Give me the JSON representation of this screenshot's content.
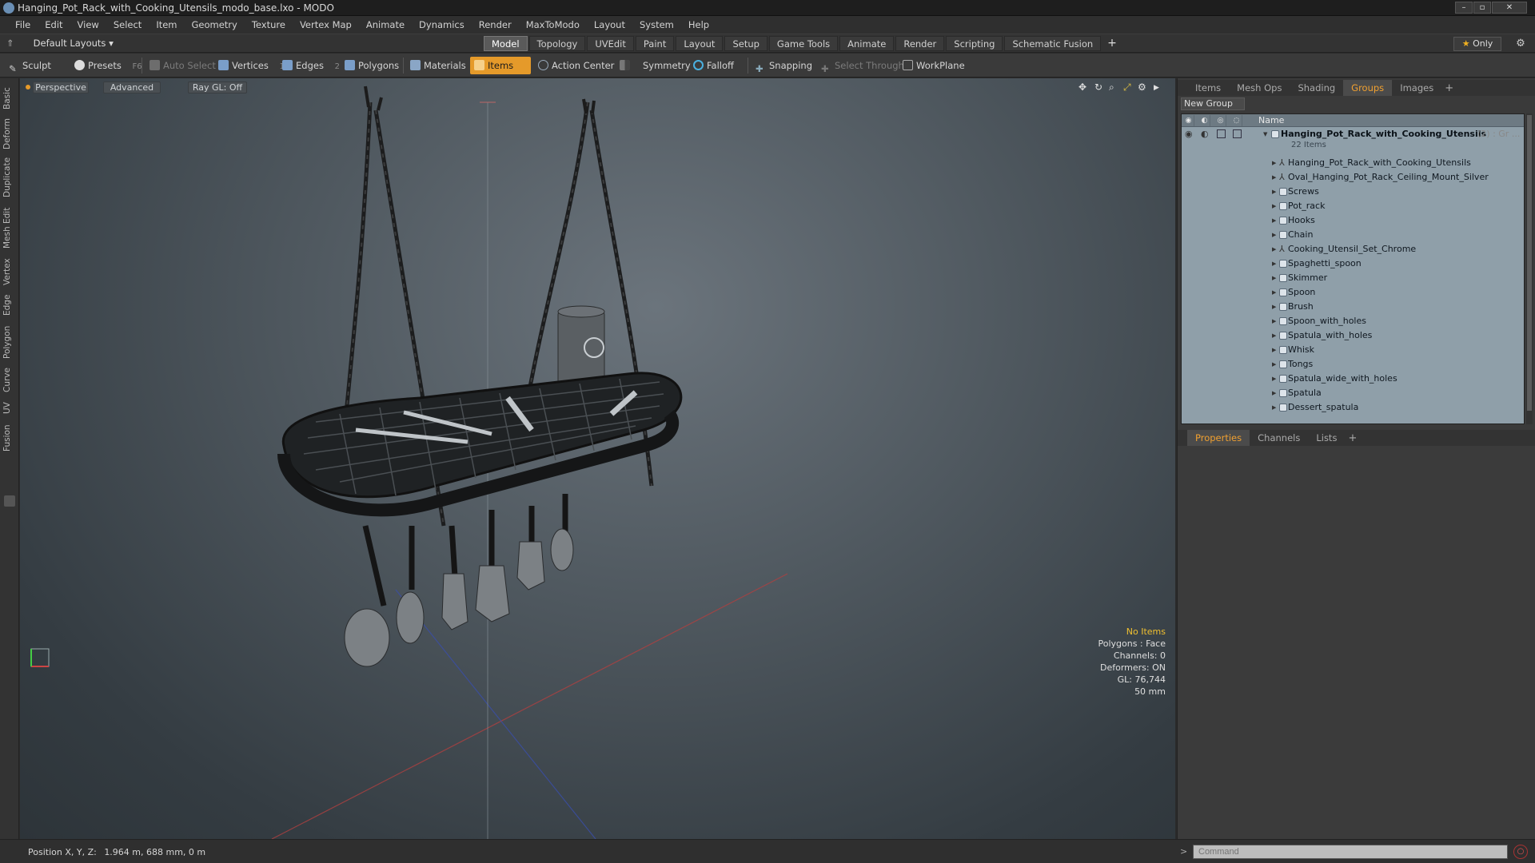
{
  "window": {
    "title": "Hanging_Pot_Rack_with_Cooking_Utensils_modo_base.lxo - MODO"
  },
  "menu": [
    "File",
    "Edit",
    "View",
    "Select",
    "Item",
    "Geometry",
    "Texture",
    "Vertex Map",
    "Animate",
    "Dynamics",
    "Render",
    "MaxToModo",
    "Layout",
    "System",
    "Help"
  ],
  "layout": {
    "selector": "Default Layouts",
    "tabs": [
      "Model",
      "Topology",
      "UVEdit",
      "Paint",
      "Layout",
      "Setup",
      "Game Tools",
      "Animate",
      "Render",
      "Scripting",
      "Schematic Fusion"
    ],
    "active_tab": "Model",
    "plus": "+",
    "only_label": "Only"
  },
  "toolbar": {
    "sculpt": "Sculpt",
    "presets": "Presets",
    "presets_key": "F6",
    "auto_select": "Auto Select",
    "vertices": "Vertices",
    "vertices_count": "1",
    "edges": "Edges",
    "edges_count": "2",
    "polygons": "Polygons",
    "materials": "Materials",
    "items": "Items",
    "action_center": "Action Center",
    "symmetry": "Symmetry",
    "falloff": "Falloff",
    "snapping": "Snapping",
    "select_through": "Select Through",
    "workplane": "WorkPlane"
  },
  "left_tabs": [
    "Basic",
    "Deform",
    "Duplicate",
    "Mesh Edit",
    "Vertex",
    "Edge",
    "Polygon",
    "Curve",
    "UV",
    "Fusion"
  ],
  "viewport": {
    "perspective": "Perspective",
    "advanced": "Advanced",
    "raygl": "Ray GL: Off",
    "info": {
      "no_items": "No Items",
      "polygons": "Polygons : Face",
      "channels": "Channels: 0",
      "deformers": "Deformers: ON",
      "gl": "GL: 76,744",
      "scale": "50 mm"
    }
  },
  "right_panel": {
    "top_tabs": [
      "Items",
      "Mesh Ops",
      "Shading",
      "Groups",
      "Images"
    ],
    "top_active": "Groups",
    "new_group": "New Group",
    "name_header": "Name",
    "root_name": "Hanging_Pot_Rack_with_Cooking_Utensils",
    "root_suffix": "(2) : Gr ...",
    "root_count": "22 Items",
    "items": [
      {
        "name": "Hanging_Pot_Rack_with_Cooking_Utensils",
        "kind": "locator"
      },
      {
        "name": "Oval_Hanging_Pot_Rack_Ceiling_Mount_Silver",
        "kind": "locator"
      },
      {
        "name": "Screws",
        "kind": "mesh"
      },
      {
        "name": "Pot_rack",
        "kind": "mesh"
      },
      {
        "name": "Hooks",
        "kind": "mesh"
      },
      {
        "name": "Chain",
        "kind": "mesh"
      },
      {
        "name": "Cooking_Utensil_Set_Chrome",
        "kind": "locator"
      },
      {
        "name": "Spaghetti_spoon",
        "kind": "mesh"
      },
      {
        "name": "Skimmer",
        "kind": "mesh"
      },
      {
        "name": "Spoon",
        "kind": "mesh"
      },
      {
        "name": "Brush",
        "kind": "mesh"
      },
      {
        "name": "Spoon_with_holes",
        "kind": "mesh"
      },
      {
        "name": "Spatula_with_holes",
        "kind": "mesh"
      },
      {
        "name": "Whisk",
        "kind": "mesh"
      },
      {
        "name": "Tongs",
        "kind": "mesh"
      },
      {
        "name": "Spatula_wide_with_holes",
        "kind": "mesh"
      },
      {
        "name": "Spatula",
        "kind": "mesh"
      },
      {
        "name": "Dessert_spatula",
        "kind": "mesh"
      }
    ],
    "bottom_tabs": [
      "Properties",
      "Channels",
      "Lists"
    ],
    "bottom_active": "Properties"
  },
  "status": {
    "position_label": "Position X, Y, Z:",
    "position_value": "1.964 m, 688 mm, 0 m",
    "command_placeholder": "Command"
  },
  "colors": {
    "accent": "#e59a2a",
    "panel": "#3a3a3a",
    "list_bg": "#8f9fa9"
  }
}
